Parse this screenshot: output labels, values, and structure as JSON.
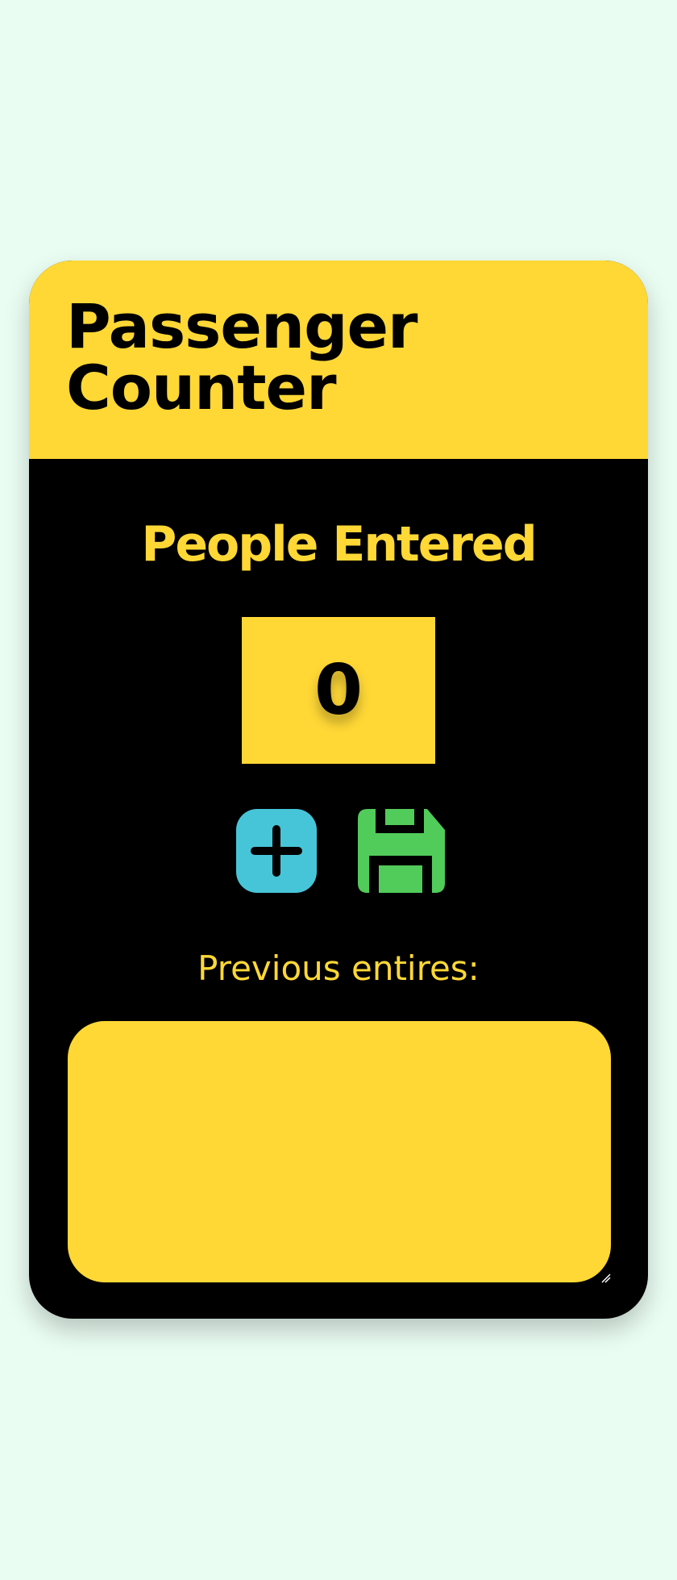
{
  "header": {
    "title_line1": "Passenger",
    "title_line2": "Counter"
  },
  "counter": {
    "heading": "People Entered",
    "value": "0"
  },
  "actions": {
    "add_icon": "plus-square-icon",
    "save_icon": "floppy-disk-icon"
  },
  "history": {
    "label": "Previous entires:",
    "entries": ""
  },
  "colors": {
    "background": "#eafdf3",
    "accent_yellow": "#ffd836",
    "card": "#000000",
    "add_button": "#47c5d8",
    "save_button": "#51cb5a"
  }
}
